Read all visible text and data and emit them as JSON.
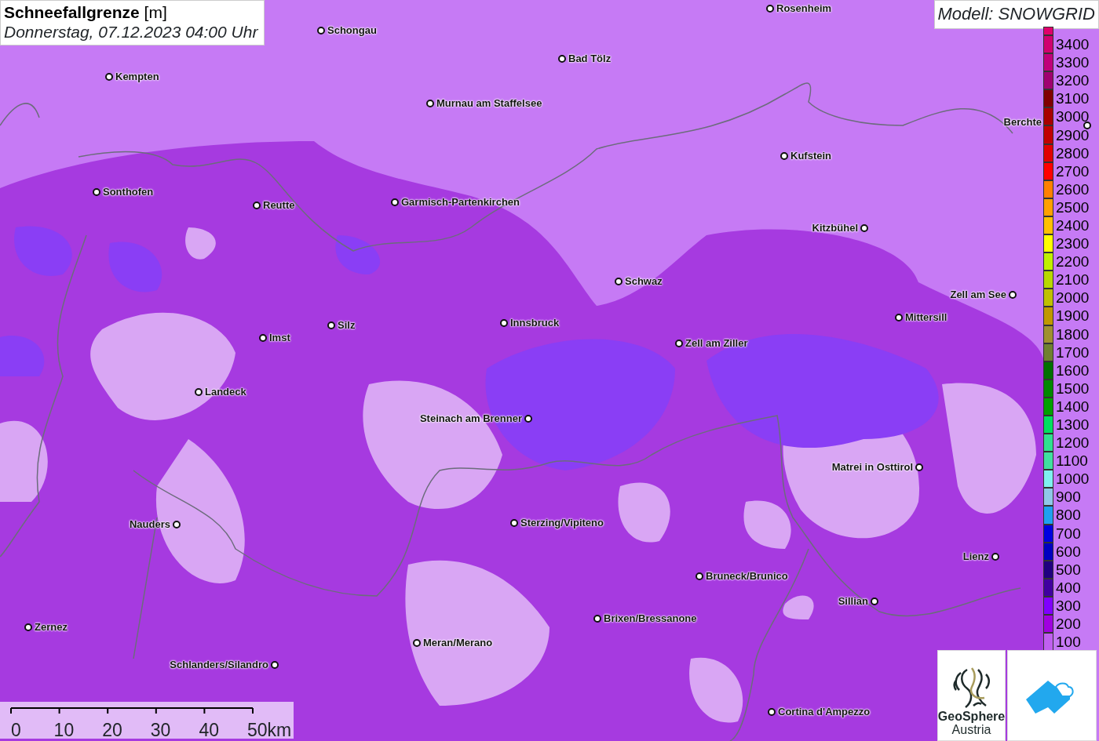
{
  "title": {
    "name": "Schneefallgrenze",
    "unit": "[m]",
    "subtitle": "Donnerstag, 07.12.2023 04:00 Uhr"
  },
  "model_label": "Modell: SNOWGRID",
  "cities": [
    {
      "name": "Rosenheim"
    },
    {
      "name": "Schongau"
    },
    {
      "name": "Bad Tölz"
    },
    {
      "name": "Kempten"
    },
    {
      "name": "Murnau am Staffelsee"
    },
    {
      "name": "Berchte"
    },
    {
      "name": "Kufstein"
    },
    {
      "name": "Sonthofen"
    },
    {
      "name": "Reutte"
    },
    {
      "name": "Garmisch-Partenkirchen"
    },
    {
      "name": "Kitzbühel"
    },
    {
      "name": "Schwaz"
    },
    {
      "name": "Zell am See"
    },
    {
      "name": "Mittersill"
    },
    {
      "name": "Innsbruck"
    },
    {
      "name": "Silz"
    },
    {
      "name": "Imst"
    },
    {
      "name": "Zell am Ziller"
    },
    {
      "name": "Landeck"
    },
    {
      "name": "Steinach am Brenner"
    },
    {
      "name": "Matrei in Osttirol"
    },
    {
      "name": "Nauders"
    },
    {
      "name": "Sterzing/Vipiteno"
    },
    {
      "name": "Lienz"
    },
    {
      "name": "Bruneck/Brunico"
    },
    {
      "name": "Sillian"
    },
    {
      "name": "Brixen/Bressanone"
    },
    {
      "name": "Zernez"
    },
    {
      "name": "Meran/Merano"
    },
    {
      "name": "Schlanders/Silandro"
    },
    {
      "name": "Cortina d'Ampezzo"
    }
  ],
  "legend": [
    {
      "label": "3400",
      "color": "#d0006f"
    },
    {
      "label": "3300",
      "color": "#c0007a"
    },
    {
      "label": "3200",
      "color": "#a00070"
    },
    {
      "label": "3100",
      "color": "#800000"
    },
    {
      "label": "3000",
      "color": "#a80000"
    },
    {
      "label": "2900",
      "color": "#c00000"
    },
    {
      "label": "2800",
      "color": "#e00000"
    },
    {
      "label": "2700",
      "color": "#ff0000"
    },
    {
      "label": "2600",
      "color": "#ff8000"
    },
    {
      "label": "2500",
      "color": "#ffa000"
    },
    {
      "label": "2400",
      "color": "#ffc000"
    },
    {
      "label": "2300",
      "color": "#ffff00"
    },
    {
      "label": "2200",
      "color": "#c0f000"
    },
    {
      "label": "2100",
      "color": "#b8d800"
    },
    {
      "label": "2000",
      "color": "#c0c000"
    },
    {
      "label": "1900",
      "color": "#c09800"
    },
    {
      "label": "1800",
      "color": "#a09030"
    },
    {
      "label": "1700",
      "color": "#708030"
    },
    {
      "label": "1600",
      "color": "#007000"
    },
    {
      "label": "1500",
      "color": "#008800"
    },
    {
      "label": "1400",
      "color": "#00a000"
    },
    {
      "label": "1300",
      "color": "#00e060"
    },
    {
      "label": "1200",
      "color": "#30e090"
    },
    {
      "label": "1100",
      "color": "#40e0a0"
    },
    {
      "label": "1000",
      "color": "#80f0f0"
    },
    {
      "label": "900",
      "color": "#90c8e8"
    },
    {
      "label": "800",
      "color": "#20a0f0"
    },
    {
      "label": "700",
      "color": "#0000e0"
    },
    {
      "label": "600",
      "color": "#0000c0"
    },
    {
      "label": "500",
      "color": "#200080"
    },
    {
      "label": "400",
      "color": "#4000a0"
    },
    {
      "label": "300",
      "color": "#8000ff"
    },
    {
      "label": "200",
      "color": "#a000e0"
    },
    {
      "label": "100",
      "color": "#c060f0"
    }
  ],
  "scale_bar": {
    "labels": [
      "0",
      "10",
      "20",
      "30",
      "40",
      "50km"
    ]
  },
  "logo": {
    "line1": "GeoSphere",
    "line2": "Austria"
  }
}
